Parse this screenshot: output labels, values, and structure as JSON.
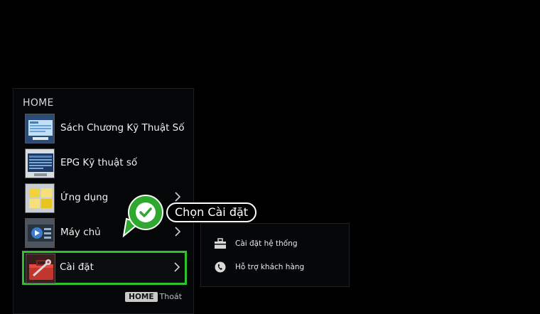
{
  "home_menu": {
    "title": "HOME",
    "items": [
      {
        "label": "Sách Chương Kỹ Thuật Số",
        "has_submenu": false
      },
      {
        "label": "EPG Kỹ thuật số",
        "has_submenu": false
      },
      {
        "label": "Ứng dụng",
        "has_submenu": true
      },
      {
        "label": "Máy chủ",
        "has_submenu": true
      },
      {
        "label": "Cài đặt",
        "has_submenu": true,
        "selected": true
      }
    ],
    "footer": {
      "key_label": "HOME",
      "action_label": "Thoát"
    }
  },
  "submenu": {
    "items": [
      {
        "label": "Cài đặt hệ thống",
        "icon": "toolbox-icon"
      },
      {
        "label": "Hỗ trợ khách hàng",
        "icon": "phone-icon"
      }
    ]
  },
  "callout": {
    "text": "Chọn Cài đặt",
    "icon": "checkmark-icon"
  },
  "colors": {
    "highlight": "#2fc12f",
    "callout_green": "#2ea82e",
    "background": "#000000"
  }
}
